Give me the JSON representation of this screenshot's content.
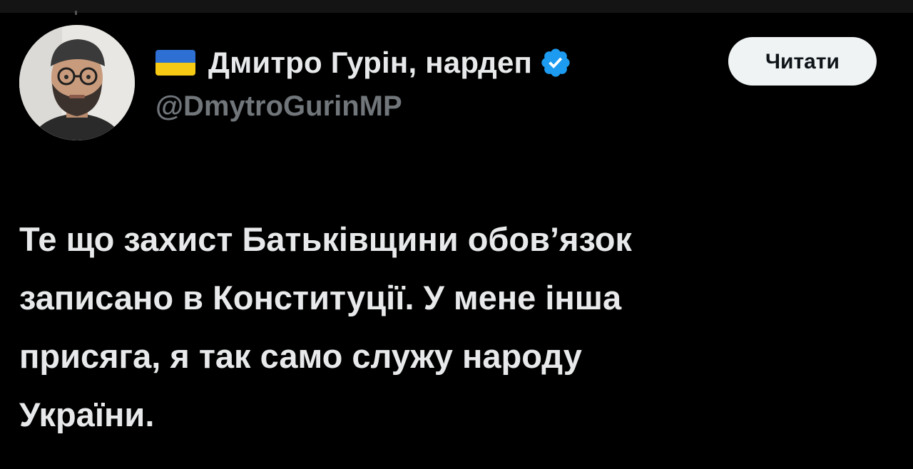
{
  "author": {
    "flag_icon": "ukraine-flag-icon",
    "display_name": "Дмитро Гурін, нардеп",
    "verified_icon": "verified-badge-icon",
    "handle": "@DmytroGurinMP"
  },
  "follow_button": {
    "label": "Читати"
  },
  "tweet": {
    "lines": [
      "Те що захист Батьківщини обов’язок",
      "записано в Конституції. У мене інша",
      "присяга, я так само служу народу",
      "України."
    ]
  },
  "colors": {
    "background": "#000000",
    "text": "#e7e9ea",
    "handle": "#71767b",
    "verified": "#1d9bf0",
    "button_bg": "#eff3f4",
    "flag_blue": "#2d6fd3",
    "flag_yellow": "#f6c915"
  }
}
